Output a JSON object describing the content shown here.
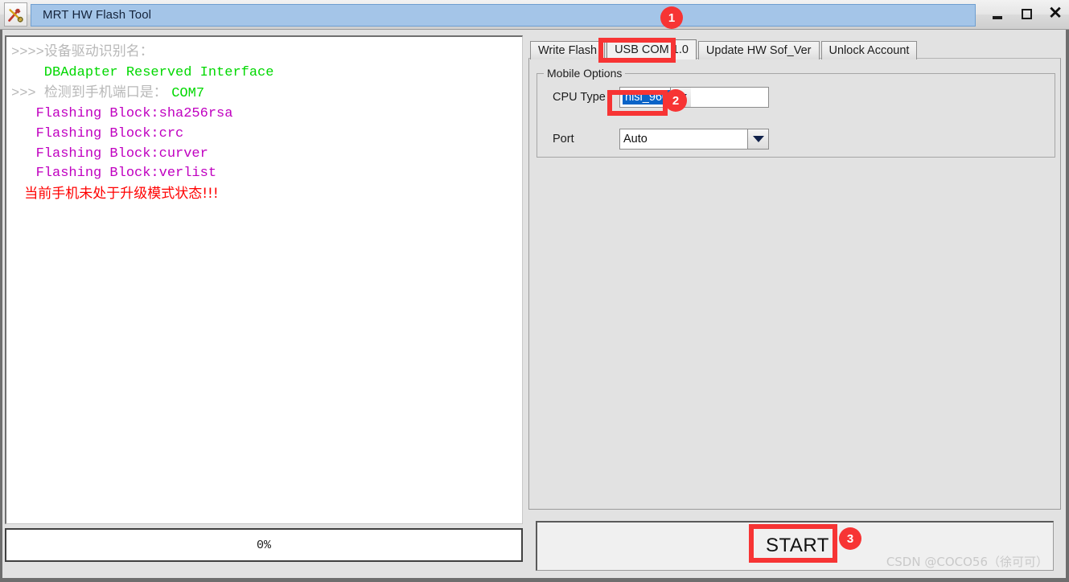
{
  "window": {
    "title": "MRT HW Flash Tool",
    "icon": "tools-icon",
    "controls": {
      "minimize": "minimize-icon",
      "maximize": "maximize-icon",
      "close": "close-icon"
    }
  },
  "log": {
    "lines": [
      [
        {
          "t": ">>>>",
          "c": "gray"
        },
        {
          "t": "设备驱动识别名：",
          "c": "gray",
          "cjk": true
        }
      ],
      [
        {
          "t": "    DBAdapter Reserved Interface",
          "c": "green"
        }
      ],
      [
        {
          "t": ">>> ",
          "c": "gray"
        },
        {
          "t": "检测到手机端口是： ",
          "c": "gray",
          "cjk": true
        },
        {
          "t": "COM7",
          "c": "green"
        }
      ],
      [
        {
          "t": "   Flashing Block:sha256rsa",
          "c": "purple"
        }
      ],
      [
        {
          "t": "   Flashing Block:crc",
          "c": "purple"
        }
      ],
      [
        {
          "t": "   Flashing Block:curver",
          "c": "purple"
        }
      ],
      [
        {
          "t": "   Flashing Block:verlist",
          "c": "purple"
        }
      ],
      [
        {
          "t": "   当前手机未处于升级模式状态!!!",
          "c": "red",
          "cjk": true
        }
      ]
    ]
  },
  "progress": {
    "label": "0%",
    "value": 0
  },
  "tabs": [
    {
      "label": "Write Flash",
      "selected": false
    },
    {
      "label": "USB COM 1.0",
      "selected": true
    },
    {
      "label": "Update HW Sof_Ver",
      "selected": false
    },
    {
      "label": "Unlock Account",
      "selected": false
    }
  ],
  "mobile_options": {
    "group_title": "Mobile Options",
    "cpu_type": {
      "label": "CPU Type",
      "value": "hisi_960",
      "text_selected": true
    },
    "port": {
      "label": "Port",
      "value": "Auto",
      "text_selected": false
    }
  },
  "start": {
    "label": "START"
  },
  "watermark": {
    "text": "CSDN @COCO56（徐可可）"
  },
  "annotations": {
    "accent_color": "#f73434",
    "badges": [
      {
        "num": "1",
        "target": "tab-usb-com"
      },
      {
        "num": "2",
        "target": "cpu-type-combobox"
      },
      {
        "num": "3",
        "target": "start-button"
      }
    ]
  }
}
